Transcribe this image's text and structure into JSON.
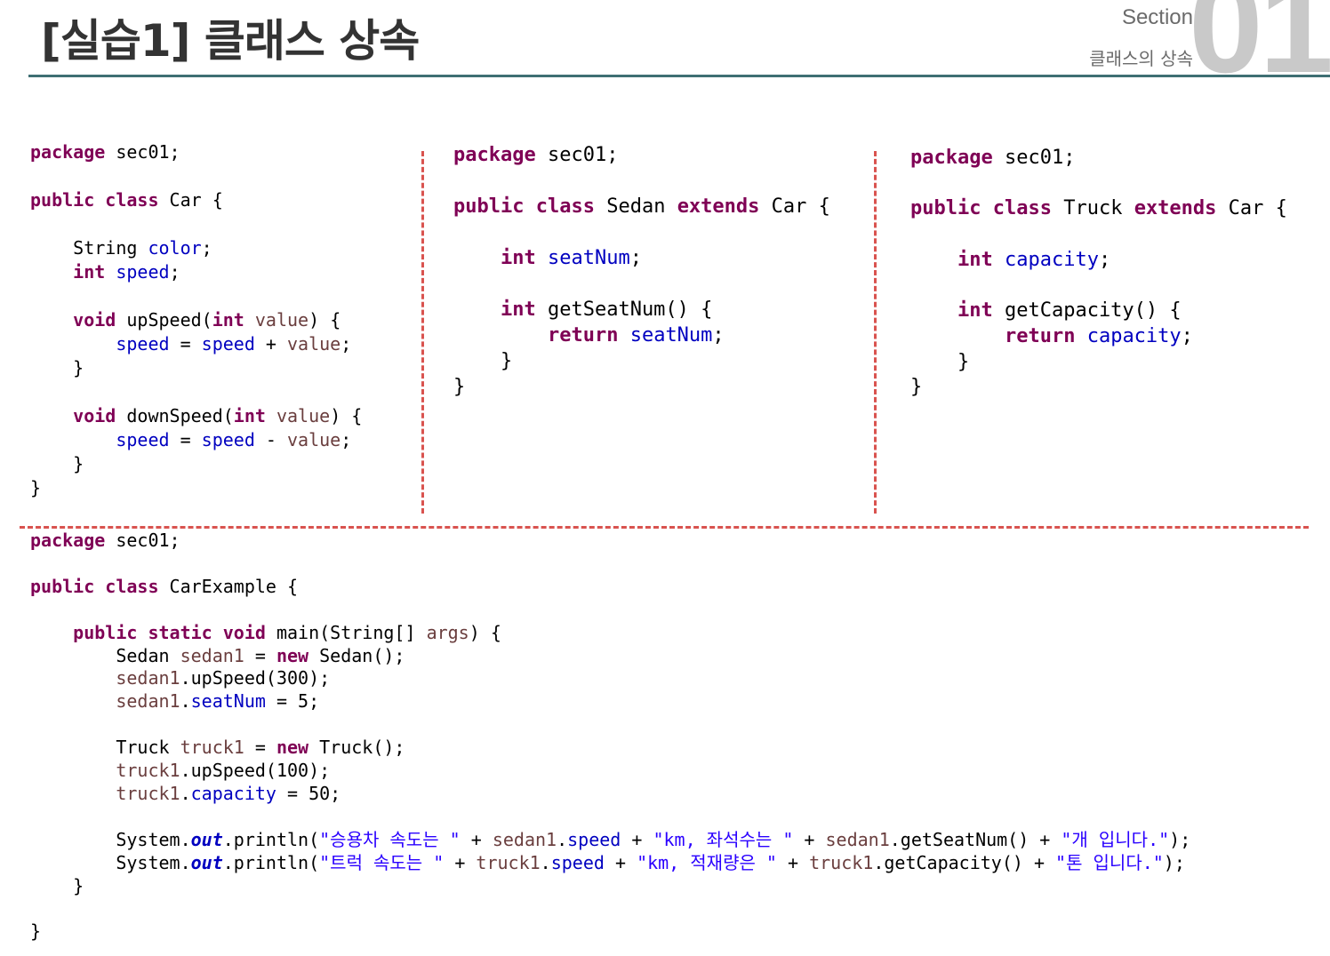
{
  "header": {
    "title": "[실습1] 클래스 상속",
    "section_label": "Section",
    "section_subtitle": "클래스의 상속",
    "section_number": "01"
  },
  "code_blocks": {
    "car": [
      "package sec01;",
      "",
      "public class Car {",
      "",
      "    String color;",
      "    int speed;",
      "",
      "    void upSpeed(int value) {",
      "        speed = speed + value;",
      "    }",
      "",
      "    void downSpeed(int value) {",
      "        speed = speed - value;",
      "    }",
      "}"
    ],
    "sedan": [
      "package sec01;",
      "",
      "public class Sedan extends Car {",
      "",
      "    int seatNum;",
      "",
      "    int getSeatNum() {",
      "        return seatNum;",
      "    }",
      "}"
    ],
    "truck": [
      "package sec01;",
      "",
      "public class Truck extends Car {",
      "",
      "    int capacity;",
      "",
      "    int getCapacity() {",
      "        return capacity;",
      "    }",
      "}"
    ],
    "car_example": [
      "package sec01;",
      "",
      "public class CarExample {",
      "",
      "    public static void main(String[] args) {",
      "        Sedan sedan1 = new Sedan();",
      "        sedan1.upSpeed(300);",
      "        sedan1.seatNum = 5;",
      "",
      "        Truck truck1 = new Truck();",
      "        truck1.upSpeed(100);",
      "        truck1.capacity = 50;",
      "",
      "        System.out.println(\"승용차 속도는 \" + sedan1.speed + \"km, 좌석수는 \" + sedan1.getSeatNum() + \"개 입니다.\");",
      "        System.out.println(\"트럭 속도는 \" + truck1.speed + \"km, 적재량은 \" + truck1.getCapacity() + \"톤 입니다.\");",
      "    }",
      "",
      "}"
    ]
  }
}
